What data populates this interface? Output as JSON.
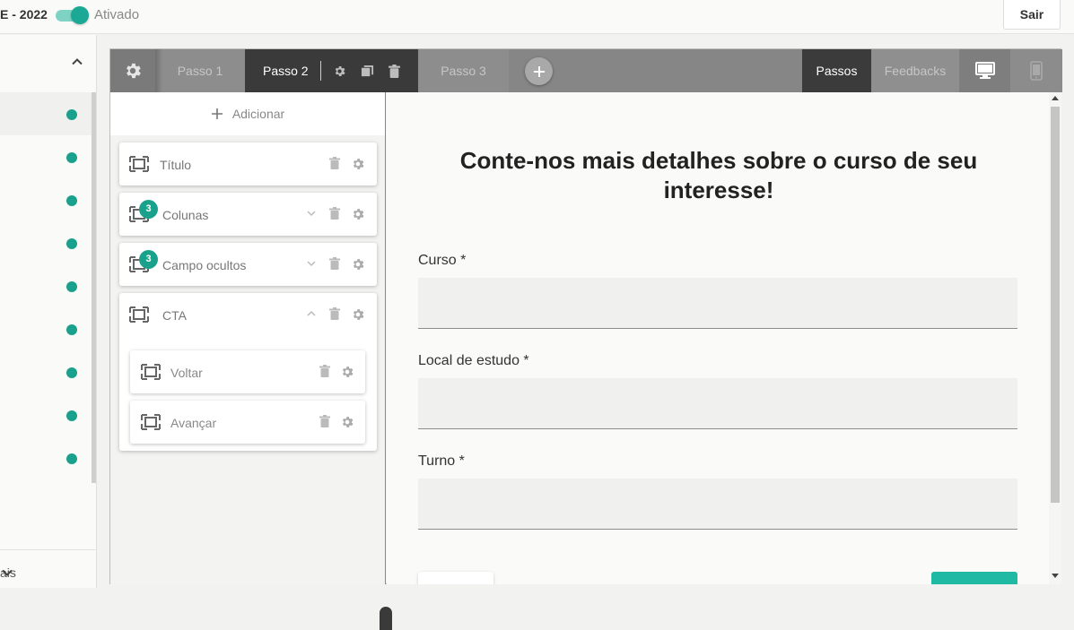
{
  "header": {
    "project_title": "E - 2022",
    "toggle_label": "Ativado",
    "toggle_on": true,
    "logout_label": "Sair"
  },
  "sidebar": {
    "status_dots": 9,
    "bottom_label": "ais",
    "accent_color": "#1aa18c"
  },
  "toolbar": {
    "settings_icon": "gear-icon",
    "steps": [
      {
        "label": "Passo 1"
      },
      {
        "label": "Passo 2",
        "active": true
      },
      {
        "label": "Passo 3"
      }
    ],
    "add_step_icon": "plus-icon",
    "view_tabs": [
      "Passos",
      "Feedbacks"
    ],
    "active_view": "Passos",
    "devices": [
      "desktop-icon",
      "mobile-icon"
    ],
    "active_device": "desktop-icon"
  },
  "blocks_panel": {
    "add_label": "Adicionar",
    "blocks": [
      {
        "label": "Título"
      },
      {
        "label": "Colunas",
        "badge": "3"
      },
      {
        "label": "Campo ocultos",
        "badge": "3"
      },
      {
        "label": "CTA",
        "expanded": true,
        "children": [
          {
            "label": "Voltar"
          },
          {
            "label": "Avançar"
          }
        ]
      }
    ]
  },
  "preview": {
    "title": "Conte-nos mais detalhes sobre o curso de seu interesse!",
    "fields": [
      {
        "label": "Curso *"
      },
      {
        "label": "Local de estudo *"
      },
      {
        "label": "Turno *"
      }
    ],
    "primary_color": "#20b9a3"
  }
}
